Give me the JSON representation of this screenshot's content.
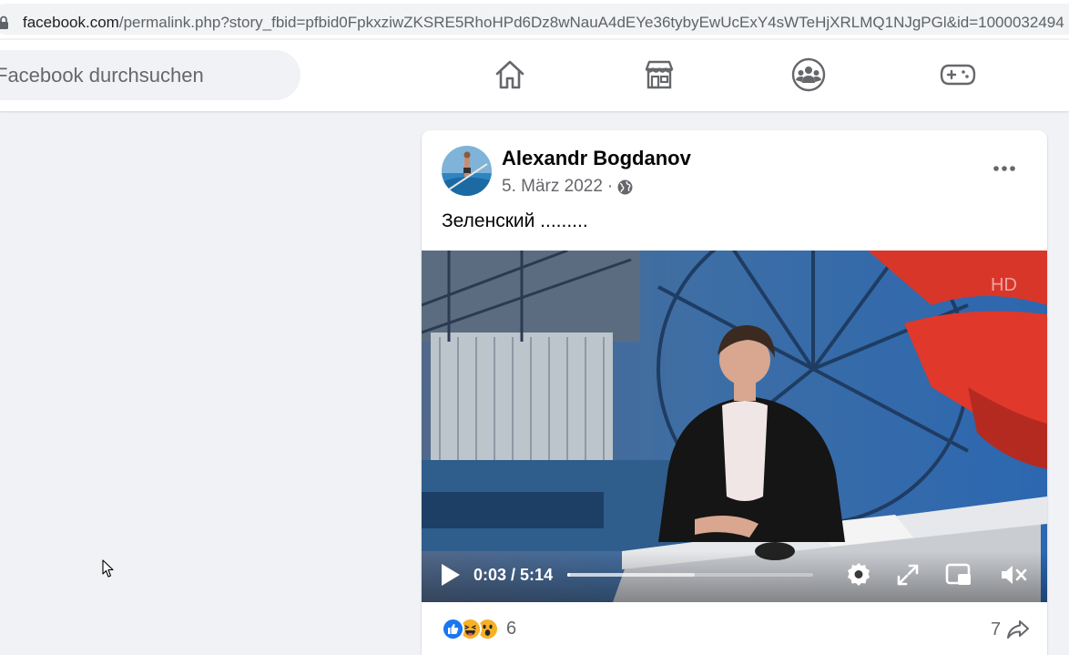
{
  "browser": {
    "url_host": "facebook.com",
    "url_path": "/permalink.php?story_fbid=pfbid0FpkxziwZKSRE5RhoHPd6Dz8wNauA4dEYe36tybyEwUcExY4sWTeHjXRLMQ1NJgPGl&id=1000032494",
    "lock_icon": "lock-icon"
  },
  "header": {
    "search_placeholder": "Facebook durchsuchen",
    "nav_icons": [
      "home-icon",
      "marketplace-icon",
      "groups-icon",
      "gaming-icon"
    ]
  },
  "post": {
    "author": "Alexandr Bogdanov",
    "date": "5. März 2022",
    "meta_separator": "·",
    "audience_icon": "globe-icon",
    "more_icon": "more-icon",
    "text": "Зеленский .........",
    "video": {
      "current_time": "0:03",
      "separator": " / ",
      "duration": "5:14",
      "progress_fraction": 0.01,
      "buffered_fraction": 0.52,
      "control_icons": [
        "play-icon",
        "settings-icon",
        "fullscreen-icon",
        "picture-in-picture-icon",
        "mute-icon"
      ]
    },
    "reactions": {
      "icons": [
        "like-reaction-icon",
        "haha-reaction-icon",
        "wow-reaction-icon"
      ],
      "count": "6"
    },
    "shares": {
      "count": "7",
      "icon": "share-icon"
    }
  },
  "colors": {
    "page_background": "#f0f2f5",
    "card_background": "#ffffff",
    "secondary_text": "#65676b",
    "primary_text": "#050505",
    "icon_gray": "#65676b",
    "like_blue": "#1877f2",
    "reaction_yellow": "#f7b125"
  }
}
